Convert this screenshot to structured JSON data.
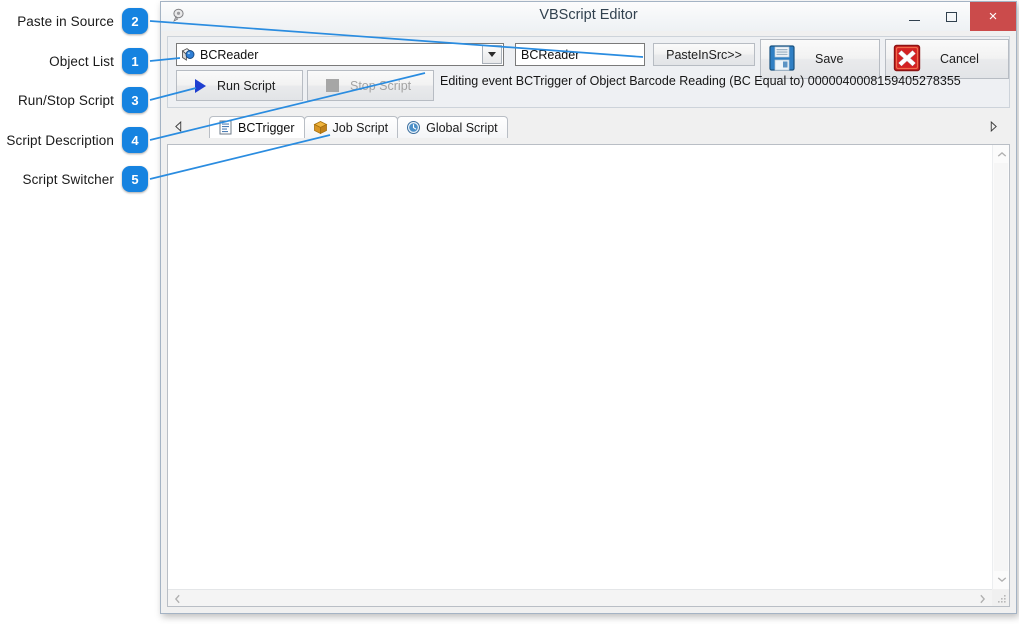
{
  "annotations": [
    {
      "label": "Paste in Source",
      "number": "2"
    },
    {
      "label": "Object List",
      "number": "1"
    },
    {
      "label": "Run/Stop Script",
      "number": "3"
    },
    {
      "label": "Script Description",
      "number": "4"
    },
    {
      "label": "Script Switcher",
      "number": "5"
    }
  ],
  "window": {
    "title": "VBScript Editor",
    "icon": "script-icon",
    "minimize_label": "–",
    "maximize_label": "□",
    "close_label": "×"
  },
  "toolbar": {
    "object_list": {
      "selected": "BCReader",
      "icon": "object-icon",
      "dropdown_icon": "chevron-down-icon"
    },
    "name_field": {
      "value": "BCReader",
      "placeholder": "BCReader"
    },
    "paste_button": "PasteInSrc>>",
    "save_button": "Save",
    "save_icon": "floppy-disk-icon",
    "cancel_button": "Cancel",
    "cancel_icon": "red-x-icon",
    "run_button": "Run Script",
    "run_icon": "play-icon",
    "stop_button": "Stop Script",
    "stop_icon": "stop-square-icon",
    "description": "Editing event BCTrigger of Object Barcode Reading (BC Equal to) 0000040008159405278355"
  },
  "tabs": {
    "scroll_left_icon": "triangle-left-icon",
    "scroll_right_icon": "triangle-right-icon",
    "items": [
      {
        "label": "BCTrigger",
        "icon": "script-document-icon",
        "active": true
      },
      {
        "label": "Job Script",
        "icon": "package-box-icon",
        "active": false
      },
      {
        "label": "Global Script",
        "icon": "globe-clock-icon",
        "active": false
      }
    ]
  },
  "editor": {
    "content": "",
    "vscroll_up_icon": "chevron-up-icon",
    "vscroll_down_icon": "chevron-down-icon",
    "hscroll_left_icon": "chevron-left-icon",
    "hscroll_right_icon": "chevron-right-icon",
    "resize_grip_icon": "resize-grip-icon"
  },
  "colors": {
    "badge": "#1683e0",
    "line": "#2a8ce0",
    "close_button": "#cb4b4b",
    "panel": "#eef0f3",
    "play": "#1f3fd0"
  }
}
